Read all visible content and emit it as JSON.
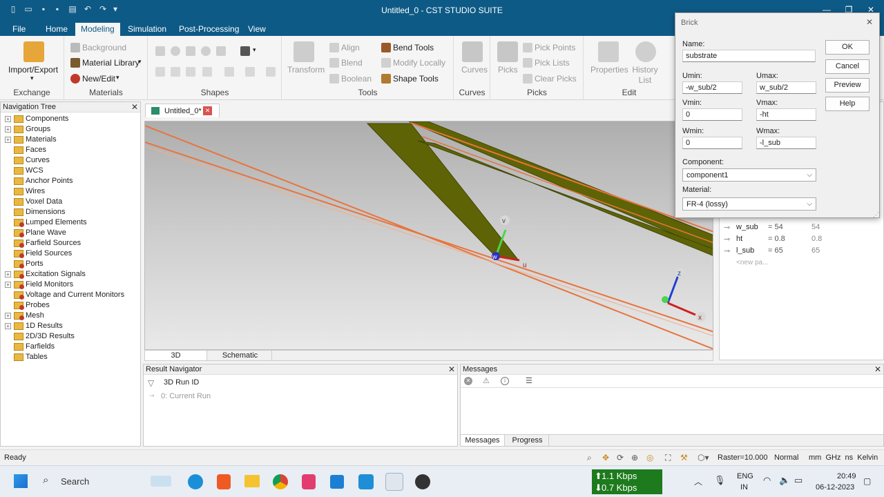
{
  "window": {
    "title": "Untitled_0 - CST STUDIO SUITE"
  },
  "menu": {
    "tabs": [
      "File",
      "Home",
      "Modeling",
      "Simulation",
      "Post-Processing",
      "View"
    ],
    "active": "Modeling"
  },
  "ribbon": {
    "exchange": {
      "import_export": "Import/Export",
      "label": "Exchange"
    },
    "materials": {
      "background": "Background",
      "material_library": "Material Library",
      "new_edit": "New/Edit",
      "label": "Materials"
    },
    "shapes": {
      "label": "Shapes"
    },
    "tools": {
      "transform": "Transform",
      "align": "Align",
      "blend": "Blend",
      "boolean": "Boolean",
      "bend_tools": "Bend Tools",
      "modify_locally": "Modify Locally",
      "shape_tools": "Shape Tools",
      "label": "Tools"
    },
    "curves": {
      "curves": "Curves",
      "label": "Curves"
    },
    "picks": {
      "picks": "Picks",
      "pick_points": "Pick Points",
      "pick_lists": "Pick Lists",
      "clear_picks": "Clear Picks",
      "label": "Picks"
    },
    "edit": {
      "properties": "Properties",
      "history_list": "History List",
      "label": "Edit"
    }
  },
  "nav_tree": {
    "title": "Navigation Tree",
    "items": [
      {
        "label": "Components",
        "expandable": true,
        "red": false
      },
      {
        "label": "Groups",
        "expandable": true,
        "red": false
      },
      {
        "label": "Materials",
        "expandable": true,
        "red": false
      },
      {
        "label": "Faces",
        "expandable": false,
        "red": false
      },
      {
        "label": "Curves",
        "expandable": false,
        "red": false
      },
      {
        "label": "WCS",
        "expandable": false,
        "red": false
      },
      {
        "label": "Anchor Points",
        "expandable": false,
        "red": false
      },
      {
        "label": "Wires",
        "expandable": false,
        "red": false
      },
      {
        "label": "Voxel Data",
        "expandable": false,
        "red": false
      },
      {
        "label": "Dimensions",
        "expandable": false,
        "red": false
      },
      {
        "label": "Lumped Elements",
        "expandable": false,
        "red": true
      },
      {
        "label": "Plane Wave",
        "expandable": false,
        "red": true
      },
      {
        "label": "Farfield Sources",
        "expandable": false,
        "red": true
      },
      {
        "label": "Field Sources",
        "expandable": false,
        "red": true
      },
      {
        "label": "Ports",
        "expandable": false,
        "red": true
      },
      {
        "label": "Excitation Signals",
        "expandable": true,
        "red": true
      },
      {
        "label": "Field Monitors",
        "expandable": true,
        "red": true
      },
      {
        "label": "Voltage and Current Monitors",
        "expandable": false,
        "red": true
      },
      {
        "label": "Probes",
        "expandable": false,
        "red": true
      },
      {
        "label": "Mesh",
        "expandable": true,
        "red": true
      },
      {
        "label": "1D Results",
        "expandable": true,
        "red": false
      },
      {
        "label": "2D/3D Results",
        "expandable": false,
        "red": false
      },
      {
        "label": "Farfields",
        "expandable": false,
        "red": false
      },
      {
        "label": "Tables",
        "expandable": false,
        "red": false
      }
    ]
  },
  "document": {
    "tab": "Untitled_0*",
    "view_tabs": [
      "3D",
      "Schematic"
    ],
    "axes": {
      "u": "u",
      "v": "v",
      "w": "w",
      "x": "x",
      "z": "z"
    }
  },
  "parameters": {
    "rows": [
      {
        "name": "w_sub",
        "expr": "= 54",
        "value": "54"
      },
      {
        "name": "ht",
        "expr": "= 0.8",
        "value": "0.8"
      },
      {
        "name": "l_sub",
        "expr": "= 65",
        "value": "65"
      }
    ],
    "new_param": "<new pa..."
  },
  "result_navigator": {
    "title": "Result Navigator",
    "col": "3D Run ID",
    "row": "0: Current Run"
  },
  "messages": {
    "title": "Messages",
    "tabs": [
      "Messages",
      "Progress"
    ]
  },
  "status": {
    "left": "Ready",
    "raster": "Raster=10.000",
    "mode": "Normal",
    "units": "mm  GHz  ns  Kelvin"
  },
  "taskbar": {
    "search": "Search",
    "net_up": "1.1 Kbps",
    "net_down": "0.7 Kbps",
    "lang1": "ENG",
    "lang2": "IN",
    "time": "20:49",
    "date": "06-12-2023"
  },
  "dialog": {
    "title": "Brick",
    "name_label": "Name:",
    "name": "substrate",
    "umin_label": "Umin:",
    "umin": "-w_sub/2",
    "umax_label": "Umax:",
    "umax": "w_sub/2",
    "vmin_label": "Vmin:",
    "vmin": "0",
    "vmax_label": "Vmax:",
    "vmax": "-ht",
    "wmin_label": "Wmin:",
    "wmin": "0",
    "wmax_label": "Wmax:",
    "wmax": "-l_sub",
    "component_label": "Component:",
    "component": "component1",
    "material_label": "Material:",
    "material": "FR-4 (lossy)",
    "ok": "OK",
    "cancel": "Cancel",
    "preview": "Preview",
    "help": "Help"
  },
  "colors": {
    "title_bar": "#0e5a86",
    "accent": "#0e5a86",
    "board": "#5e6406",
    "copper": "#e8743c"
  }
}
